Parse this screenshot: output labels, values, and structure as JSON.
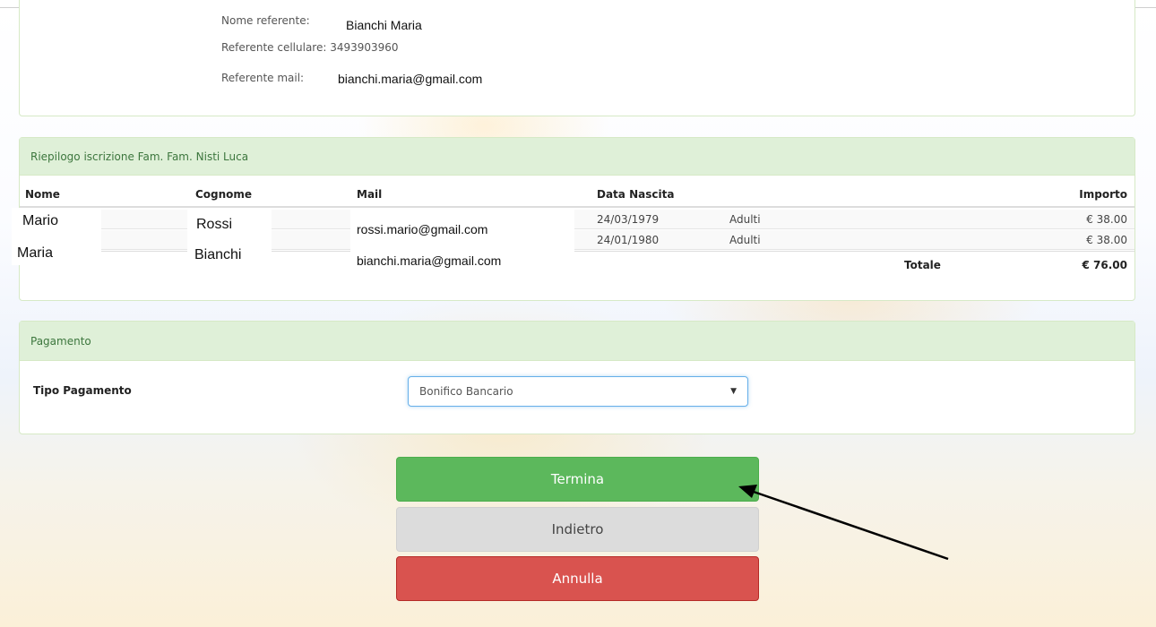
{
  "referente": {
    "nome_label": "Nome referente: ",
    "nome_value": "Bianchi Maria",
    "cellulare_label": "Referente cellulare: 3493903960",
    "mail_label": "Referente mail:",
    "mail_value": "bianchi.maria@gmail.com"
  },
  "riepilogo": {
    "title": "Riepilogo iscrizione Fam. Fam. Nisti Luca",
    "columns": [
      "Nome",
      "Cognome",
      "Mail",
      "Data Nascita",
      "Importo"
    ],
    "rows": [
      {
        "nome": "Mario",
        "cognome": "Rossi",
        "mail": "rossi.mario@gmail.com",
        "data": "24/03/1979",
        "tipo": "Adulti",
        "importo": "€ 38.00"
      },
      {
        "nome": "Maria",
        "cognome": "Bianchi",
        "mail": "bianchi.maria@gmail.com",
        "data": "24/01/1980",
        "tipo": "Adulti",
        "importo": "€ 38.00"
      }
    ],
    "totale_label": "Totale",
    "totale_value": "€ 76.00"
  },
  "pagamento": {
    "title": "Pagamento",
    "tipo_label": "Tipo Pagamento",
    "selected": "Bonifico Bancario",
    "caret": "▼"
  },
  "buttons": {
    "termina": "Termina",
    "indietro": "Indietro",
    "annulla": "Annulla"
  },
  "colors": {
    "success": "#5cb85c",
    "danger": "#d9534f",
    "default": "#dcdcdc",
    "panel_heading_bg": "#dff0d8"
  }
}
